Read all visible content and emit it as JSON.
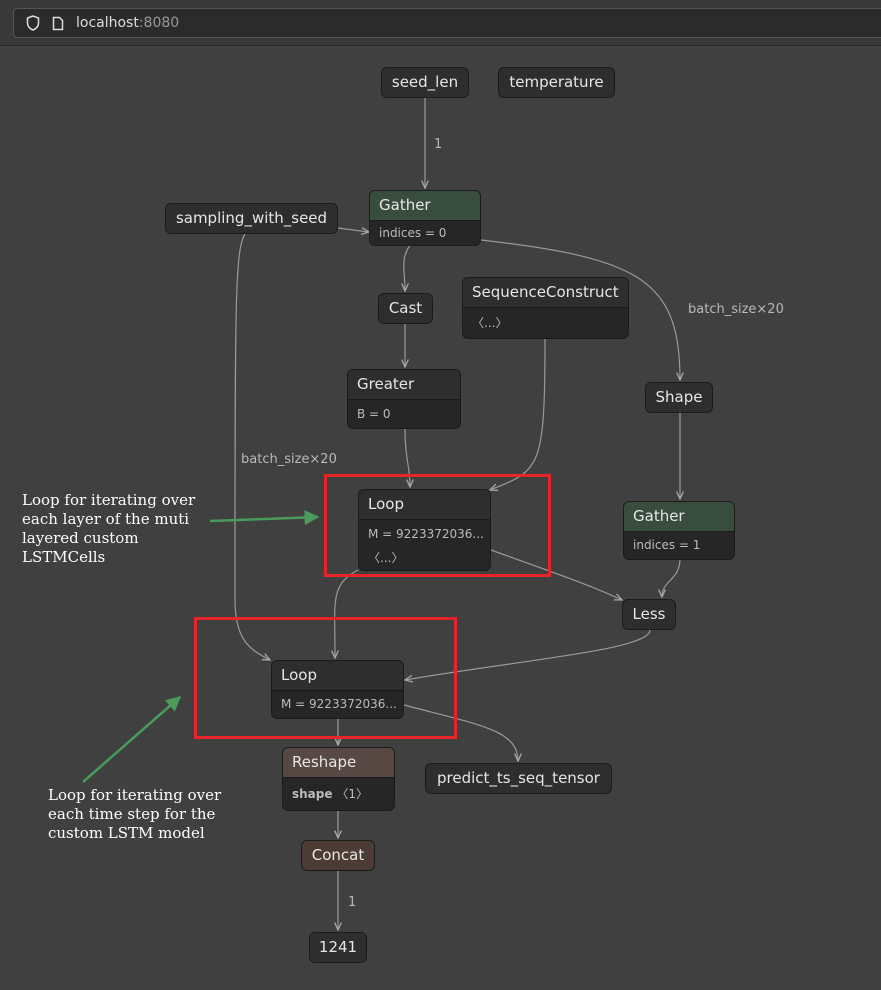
{
  "browser": {
    "host": "localhost",
    "port": ":8080",
    "icons": [
      "shield-icon",
      "page-icon"
    ]
  },
  "nodes": {
    "seed_len": "seed_len",
    "temperature": "temperature",
    "gather1": {
      "title": "Gather",
      "attr": "indices = 0"
    },
    "sampling": "sampling_with_seed",
    "cast": "Cast",
    "seqconstruct": {
      "title": "SequenceConstruct",
      "attr": "〈...〉"
    },
    "greater": {
      "title": "Greater",
      "attr": "B = 0"
    },
    "shape": "Shape",
    "loop1": {
      "title": "Loop",
      "attr": "M = 9223372036...",
      "attr2": "〈...〉"
    },
    "gather2": {
      "title": "Gather",
      "attr": "indices = 1"
    },
    "less": "Less",
    "loop2": {
      "title": "Loop",
      "attr": "M = 9223372036..."
    },
    "reshape": {
      "title": "Reshape",
      "attr_key": "shape",
      "attr_val": "〈1〉"
    },
    "predict": "predict_ts_seq_tensor",
    "concat": "Concat",
    "out": "1241"
  },
  "edge_labels": {
    "e1": "1",
    "e2": "batch_size×20",
    "e3": "batch_size×20",
    "e4": "1"
  },
  "annotations": {
    "a1": "Loop for iterating over\neach layer of the muti\nlayered custom\nLSTMCells",
    "a2": "Loop for iterating over\neach time step for the\ncustom LSTM model"
  },
  "colors": {
    "highlight": "#e8232a",
    "arrow": "#4a9a5a"
  }
}
